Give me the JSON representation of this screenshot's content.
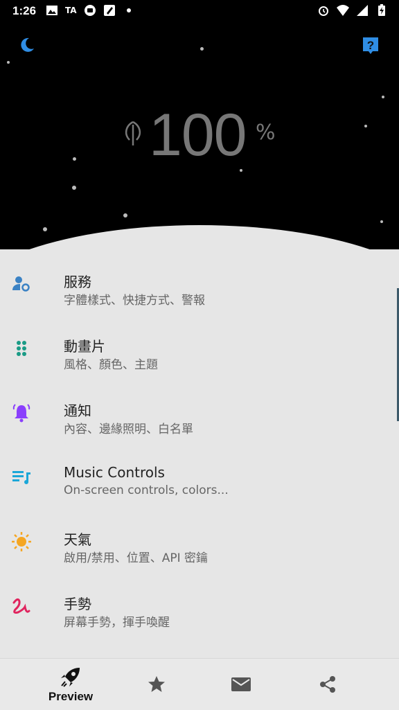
{
  "status_bar": {
    "time": "1:26",
    "left_icons": [
      "image-icon",
      "ta-icon",
      "lock-circle-icon",
      "edit-icon",
      "dot-icon"
    ],
    "right_icons": [
      "alarm-icon",
      "wifi-icon",
      "signal-icon",
      "battery-charging-icon"
    ],
    "ta_text": "TA"
  },
  "hero": {
    "battery_value": "100",
    "battery_unit": "%"
  },
  "list": {
    "items": [
      {
        "title": "服務",
        "subtitle": "字體樣式、快捷方式、警報",
        "icon": "person-gear-icon",
        "color": "#3b82c4"
      },
      {
        "title": "動畫片",
        "subtitle": "風格、顏色、主題",
        "icon": "dots-grid-icon",
        "color": "#1a9b86"
      },
      {
        "title": "通知",
        "subtitle": "內容、邊緣照明、白名單",
        "icon": "bell-ring-icon",
        "color": "#8a3ffc"
      },
      {
        "title": "Music Controls",
        "subtitle": "On-screen controls, colors...",
        "icon": "music-list-icon",
        "color": "#1ba7d8"
      },
      {
        "title": "天氣",
        "subtitle": "啟用/禁用、位置、API 密鑰",
        "icon": "sun-icon",
        "color": "#f5a623"
      },
      {
        "title": "手勢",
        "subtitle": "屏幕手勢，揮手喚醒",
        "icon": "gesture-icon",
        "color": "#e0245e"
      }
    ]
  },
  "bottom_nav": {
    "preview_label": "Preview",
    "buttons": [
      "rocket-icon",
      "star-icon",
      "mail-icon",
      "share-icon"
    ]
  },
  "colors": {
    "hero_bg": "#000000",
    "page_bg": "#e6e6e6",
    "moon": "#2f8de4",
    "help": "#2f8de4"
  }
}
